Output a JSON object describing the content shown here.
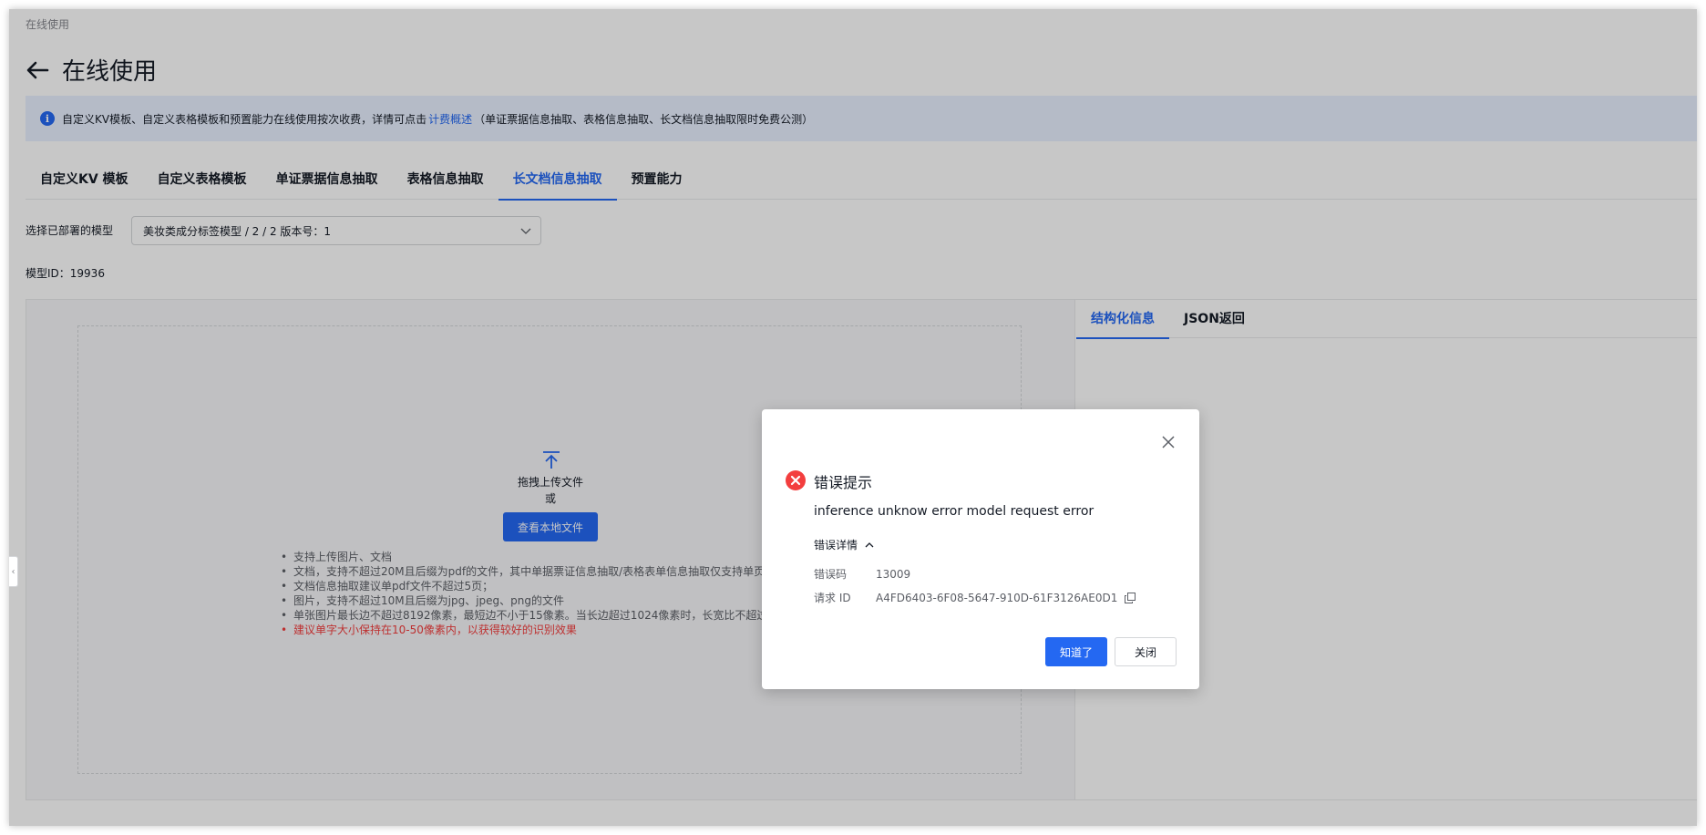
{
  "breadcrumb": "在线使用",
  "page": {
    "title": "在线使用"
  },
  "notice": {
    "text_before": "自定义KV模板、自定义表格模板和预置能力在线使用按次收费，详情可点击",
    "link": "计费概述",
    "text_after": "（单证票据信息抽取、表格信息抽取、长文档信息抽取限时免费公测）"
  },
  "tabs": [
    {
      "label": "自定义KV 模板"
    },
    {
      "label": "自定义表格模板"
    },
    {
      "label": "单证票据信息抽取"
    },
    {
      "label": "表格信息抽取"
    },
    {
      "label": "长文档信息抽取",
      "active": true
    },
    {
      "label": "预置能力"
    }
  ],
  "model": {
    "label": "选择已部署的模型",
    "selected": "美妆类成分标签模型 / 2 / 2 版本号：1",
    "id_label": "模型ID：",
    "id_value": "19936"
  },
  "upload": {
    "drag_text": "拖拽上传文件",
    "or_text": "或",
    "browse_label": "查看本地文件",
    "requirements": [
      "支持上传图片、文档",
      "文档，支持不超过20M且后缀为pdf的文件，其中单据票证信息抽取/表格表单信息抽取仅支持单页",
      "文档信息抽取建议单pdf文件不超过5页；",
      "图片，支持不超过10M且后缀为jpg、jpeg、png的文件",
      "单张图片最长边不超过8192像素，最短边不小于15像素。当长边超过1024像素时，长宽比不超过",
      "建议单字大小保持在10-50像素内，以获得较好的识别效果"
    ]
  },
  "result_tabs": [
    {
      "label": "结构化信息",
      "active": true
    },
    {
      "label": "JSON返回"
    }
  ],
  "dialog": {
    "title": "错误提示",
    "message": "inference unknow error model request error",
    "details_label": "错误详情",
    "code_label": "错误码",
    "code_value": "13009",
    "request_id_label": "请求 ID",
    "request_id_value": "A4FD6403-6F08-5647-910D-61F3126AE0D1",
    "ok_label": "知道了",
    "close_label": "关闭"
  },
  "colors": {
    "primary": "#2468f2",
    "error": "#f33e3e",
    "notice_bg": "#e8f0ff"
  }
}
